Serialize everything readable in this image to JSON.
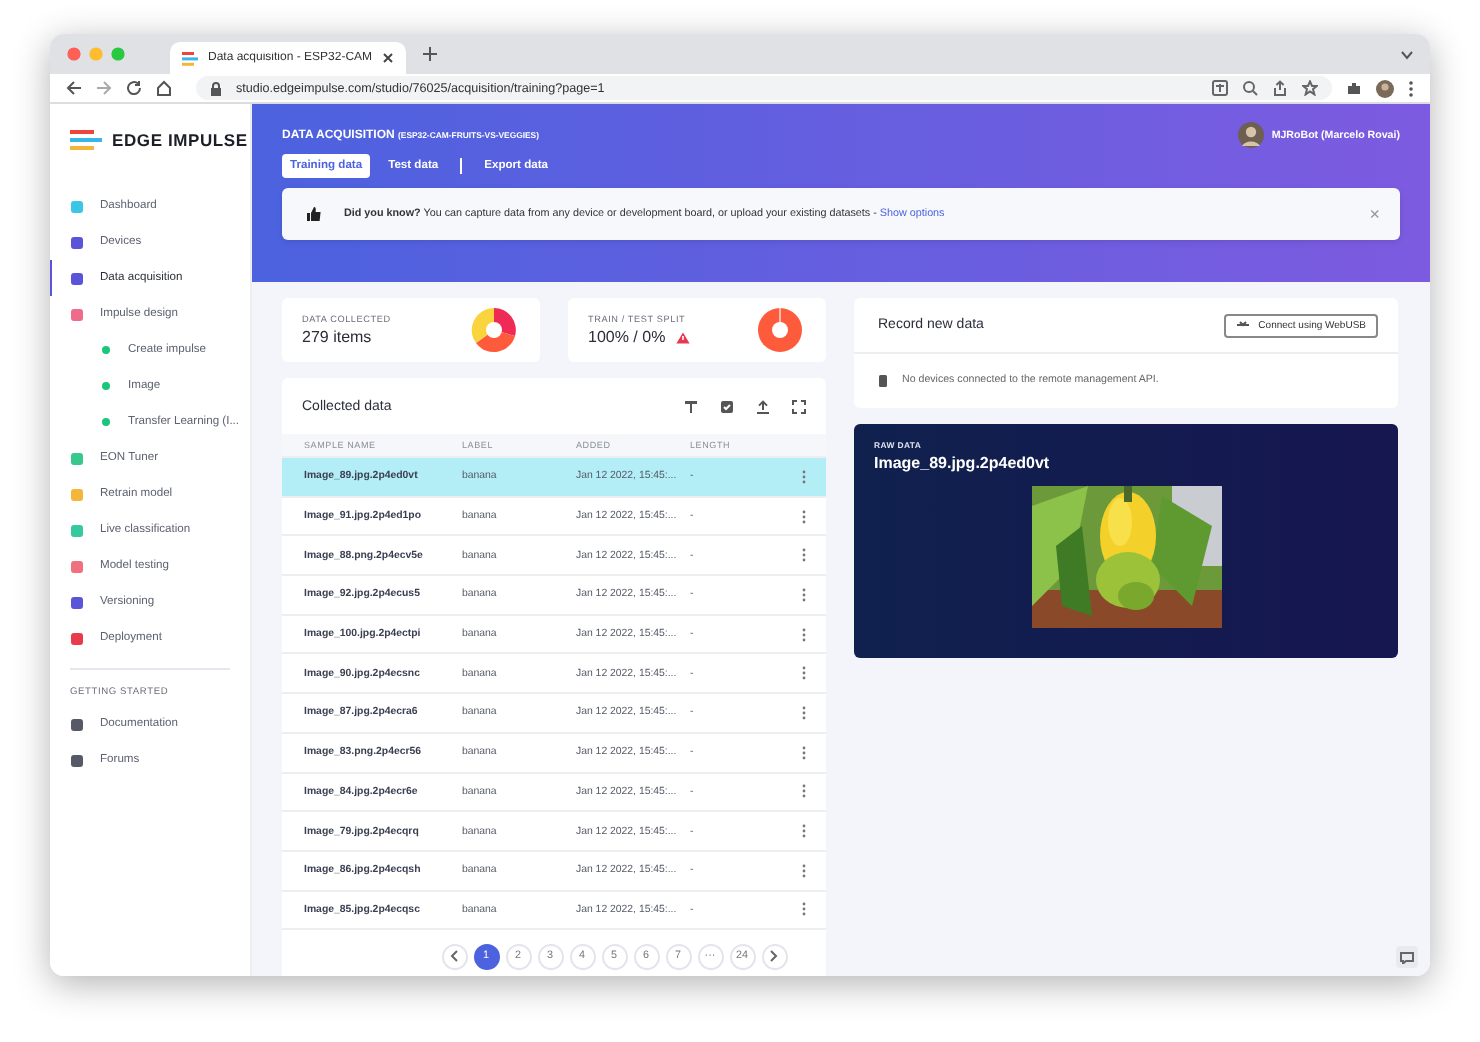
{
  "browser": {
    "tab_title": "Data acquisition - ESP32-CAM",
    "url": "studio.edgeimpulse.com/studio/76025/acquisition/training?page=1"
  },
  "sidebar": {
    "logo": "EDGE IMPULSE",
    "items": [
      {
        "label": "Dashboard",
        "selected": false,
        "color": "#3cc6e6"
      },
      {
        "label": "Devices",
        "selected": false,
        "color": "#5a55d8"
      },
      {
        "label": "Data acquisition",
        "selected": true,
        "color": "#5a55d8"
      },
      {
        "label": "Impulse design",
        "selected": false,
        "color": "#f06a8a",
        "children": [
          {
            "label": "Create impulse",
            "color": "#18c77a"
          },
          {
            "label": "Image",
            "color": "#18c77a"
          },
          {
            "label": "Transfer Learning (I...",
            "color": "#18c77a"
          }
        ]
      },
      {
        "label": "EON Tuner",
        "selected": false,
        "color": "#36c98b"
      },
      {
        "label": "Retrain model",
        "selected": false,
        "color": "#f4b63a"
      },
      {
        "label": "Live classification",
        "selected": false,
        "color": "#36c9a0"
      },
      {
        "label": "Model testing",
        "selected": false,
        "color": "#f07080"
      },
      {
        "label": "Versioning",
        "selected": false,
        "color": "#5a55d8"
      },
      {
        "label": "Deployment",
        "selected": false,
        "color": "#e83a4a"
      }
    ],
    "section_title": "GETTING STARTED",
    "help_items": [
      {
        "label": "Documentation",
        "color": "#555a66"
      },
      {
        "label": "Forums",
        "color": "#555a66"
      }
    ]
  },
  "header": {
    "title": "DATA ACQUISITION",
    "project": "(ESP32-CAM-FRUITS-VS-VEGGIES)",
    "user": "MJRoBot (Marcelo Rovai)",
    "tabs": [
      {
        "label": "Training data",
        "selected": true
      },
      {
        "label": "Test data",
        "selected": false
      },
      {
        "label": "Export data",
        "selected": false
      }
    ]
  },
  "banner": {
    "text": "**Did you know?** You can capture data from any device or development board, or upload your existing datasets - ",
    "link": "Show options",
    "close": "×"
  },
  "stats": [
    {
      "label": "DATA COLLECTED",
      "value": "279 items",
      "warning": false
    },
    {
      "label": "TRAIN / TEST SPLIT",
      "value": "100% / 0%",
      "warning": true
    }
  ],
  "collected": {
    "title": "Collected data",
    "columns": [
      "SAMPLE NAME",
      "LABEL",
      "ADDED",
      "LENGTH"
    ],
    "rows": [
      {
        "name": "Image_89.jpg.2p4ed0vt",
        "label": "banana",
        "added": "Jan 12 2022, 15:45:...",
        "length": "-",
        "selected": true
      },
      {
        "name": "Image_91.jpg.2p4ed1po",
        "label": "banana",
        "added": "Jan 12 2022, 15:45:...",
        "length": "-",
        "selected": false
      },
      {
        "name": "Image_88.png.2p4ecv5e",
        "label": "banana",
        "added": "Jan 12 2022, 15:45:...",
        "length": "-",
        "selected": false
      },
      {
        "name": "Image_92.jpg.2p4ecus5",
        "label": "banana",
        "added": "Jan 12 2022, 15:45:...",
        "length": "-",
        "selected": false
      },
      {
        "name": "Image_100.jpg.2p4ectpi",
        "label": "banana",
        "added": "Jan 12 2022, 15:45:...",
        "length": "-",
        "selected": false
      },
      {
        "name": "Image_90.jpg.2p4ecsnc",
        "label": "banana",
        "added": "Jan 12 2022, 15:45:...",
        "length": "-",
        "selected": false
      },
      {
        "name": "Image_87.jpg.2p4ecra6",
        "label": "banana",
        "added": "Jan 12 2022, 15:45:...",
        "length": "-",
        "selected": false
      },
      {
        "name": "Image_83.png.2p4ecr56",
        "label": "banana",
        "added": "Jan 12 2022, 15:45:...",
        "length": "-",
        "selected": false
      },
      {
        "name": "Image_84.jpg.2p4ecr6e",
        "label": "banana",
        "added": "Jan 12 2022, 15:45:...",
        "length": "-",
        "selected": false
      },
      {
        "name": "Image_79.jpg.2p4ecqrq",
        "label": "banana",
        "added": "Jan 12 2022, 15:45:...",
        "length": "-",
        "selected": false
      },
      {
        "name": "Image_86.jpg.2p4ecqsh",
        "label": "banana",
        "added": "Jan 12 2022, 15:45:...",
        "length": "-",
        "selected": false
      },
      {
        "name": "Image_85.jpg.2p4ecqsc",
        "label": "banana",
        "added": "Jan 12 2022, 15:45:...",
        "length": "-",
        "selected": false
      }
    ],
    "pages": [
      {
        "label": "1",
        "selected": true
      },
      {
        "label": "2",
        "selected": false
      },
      {
        "label": "3",
        "selected": false
      },
      {
        "label": "4",
        "selected": false
      },
      {
        "label": "5",
        "selected": false
      },
      {
        "label": "6",
        "selected": false
      },
      {
        "label": "7",
        "selected": false
      },
      {
        "label": "···",
        "selected": false
      },
      {
        "label": "24",
        "selected": false
      }
    ]
  },
  "record": {
    "title": "Record new data",
    "button": "Connect using WebUSB",
    "message": "No devices connected to the remote management API."
  },
  "raw": {
    "label": "RAW DATA",
    "name": "Image_89.jpg.2p4ed0vt",
    "kind": "picture"
  }
}
